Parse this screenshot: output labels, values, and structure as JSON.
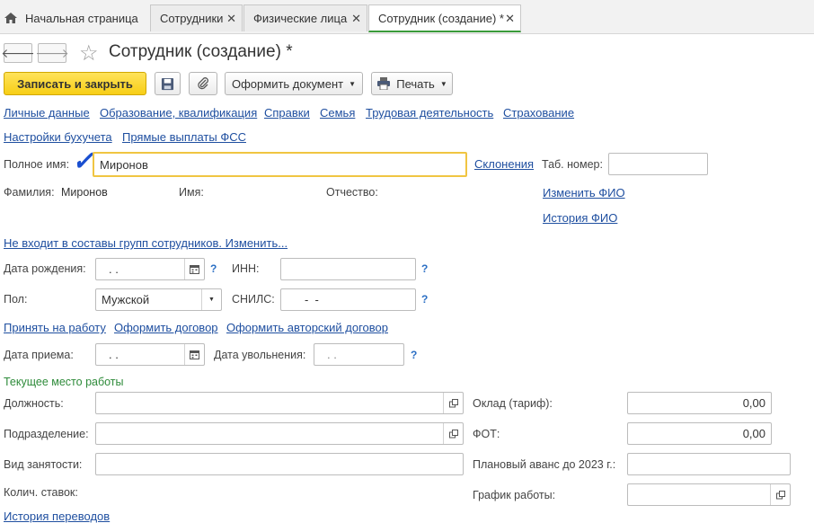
{
  "tabs": {
    "home": "Начальная страница",
    "t1": "Сотрудники",
    "t2": "Физические лица",
    "t3": "Сотрудник (создание) *"
  },
  "title": "Сотрудник (создание) *",
  "toolbar": {
    "save_close": "Записать и закрыть",
    "issue_doc": "Оформить документ",
    "print": "Печать"
  },
  "links_row1": [
    "Личные данные",
    "Образование, квалификация",
    "Справки",
    "Семья",
    "Трудовая деятельность",
    "Страхование"
  ],
  "links_row2": [
    "Настройки бухучета",
    "Прямые выплаты ФСС"
  ],
  "fullname": {
    "label": "Полное имя:",
    "value": "Миронов",
    "declension": "Склонения",
    "tab_label": "Таб. номер:",
    "tab_value": ""
  },
  "fio": {
    "surname_label": "Фамилия:",
    "surname": "Миронов",
    "name_label": "Имя:",
    "patronymic_label": "Отчество:",
    "change": "Изменить ФИО",
    "history": "История ФИО"
  },
  "groups_link": "Не входит в составы групп сотрудников. Изменить...",
  "birth": {
    "label": "Дата рождения:",
    "value": ". .",
    "inn_label": "ИНН:",
    "inn_value": ""
  },
  "gender": {
    "label": "Пол:",
    "value": "Мужской",
    "snils_label": "СНИЛС:",
    "snils_value": "-  -"
  },
  "links_row3": [
    "Принять на работу",
    "Оформить договор",
    "Оформить авторский договор"
  ],
  "hire": {
    "label": "Дата приема:",
    "value": ". .",
    "fire_label": "Дата увольнения:",
    "fire_value": ". ."
  },
  "current_work": "Текущее место работы",
  "work": {
    "position_label": "Должность:",
    "department_label": "Подразделение:",
    "employment_label": "Вид занятости:",
    "rate_label": "Колич. ставок:",
    "salary_label": "Оклад (тариф):",
    "salary_value": "0,00",
    "fot_label": "ФОТ:",
    "fot_value": "0,00",
    "advance_label": "Плановый аванс до 2023 г.:",
    "schedule_label": "График работы:"
  },
  "transfers_link": "История переводов",
  "help_mark": "?",
  "colors": {
    "primary": "#f7ce16",
    "link": "#1f4fa0",
    "section": "#2e8b3a",
    "active_tab": "#3a9b3a"
  }
}
